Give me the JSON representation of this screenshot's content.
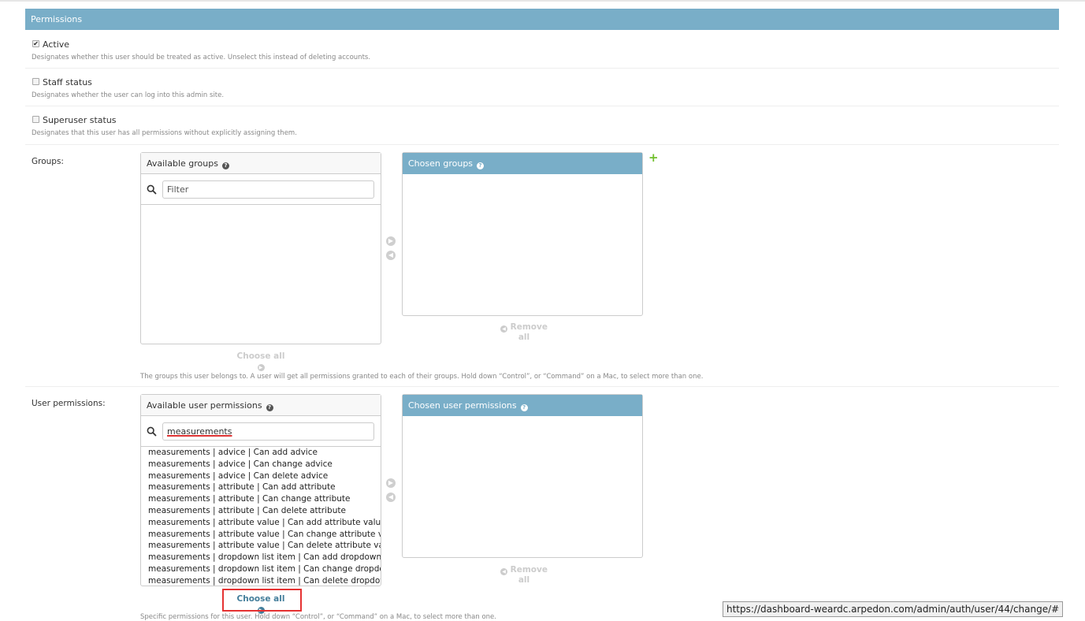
{
  "fieldset": {
    "title": "Permissions"
  },
  "active": {
    "label": "Active",
    "checked": true,
    "help": "Designates whether this user should be treated as active. Unselect this instead of deleting accounts."
  },
  "staff": {
    "label": "Staff status",
    "checked": false,
    "help": "Designates whether the user can log into this admin site."
  },
  "superuser": {
    "label": "Superuser status",
    "checked": false,
    "help": "Designates that this user has all permissions without explicitly assigning them."
  },
  "groups": {
    "label": "Groups:",
    "available_title": "Available groups",
    "chosen_title": "Chosen groups",
    "filter_placeholder": "Filter",
    "filter_value": "",
    "choose_all": "Choose all",
    "remove_all": "Remove all",
    "help": "The groups this user belongs to. A user will get all permissions granted to each of their groups. Hold down “Control”, or “Command” on a Mac, to select more than one."
  },
  "user_permissions": {
    "label": "User permissions:",
    "available_title": "Available user permissions",
    "chosen_title": "Chosen user permissions",
    "filter_value": "measurements",
    "choose_all": "Choose all",
    "remove_all": "Remove all",
    "options": [
      "measurements | advice | Can add advice",
      "measurements | advice | Can change advice",
      "measurements | advice | Can delete advice",
      "measurements | attribute | Can add attribute",
      "measurements | attribute | Can change attribute",
      "measurements | attribute | Can delete attribute",
      "measurements | attribute value | Can add attribute value",
      "measurements | attribute value | Can change attribute value",
      "measurements | attribute value | Can delete attribute value",
      "measurements | dropdown list item | Can add dropdown list item",
      "measurements | dropdown list item | Can change dropdown list item",
      "measurements | dropdown list item | Can delete dropdown list item"
    ],
    "help_cut": "Specific permissions for this user. Hold down “Control”, or “Command” on a Mac, to select more than one."
  },
  "status_bar": {
    "url": "https://dashboard-weardc.arpedon.com/admin/auth/user/44/change/#"
  }
}
